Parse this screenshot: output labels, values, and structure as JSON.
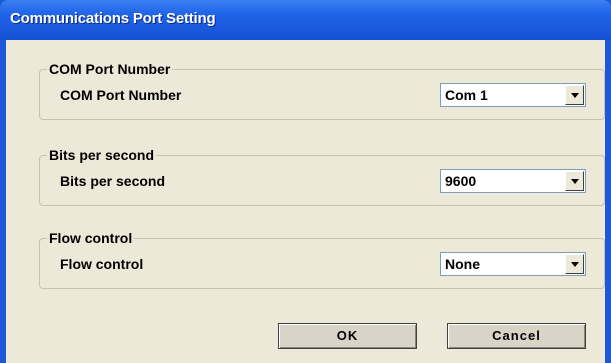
{
  "window": {
    "title": "Communications Port Setting"
  },
  "groups": [
    {
      "title": "COM Port Number",
      "label": "COM Port Number",
      "value": "Com 1"
    },
    {
      "title": "Bits per second",
      "label": "Bits per second",
      "value": "9600"
    },
    {
      "title": "Flow control",
      "label": "Flow control",
      "value": "None"
    }
  ],
  "buttons": {
    "ok": "OK",
    "cancel": "Cancel"
  },
  "icons": {
    "dropdown": "chevron-down-icon"
  },
  "colors": {
    "titlebar": "#2064e8",
    "background": "#ece9d8",
    "frame": "#1d58d8"
  }
}
